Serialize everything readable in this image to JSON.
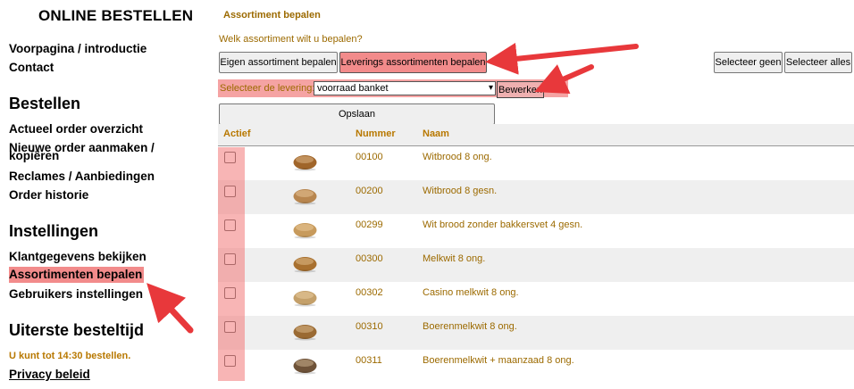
{
  "sidebar": {
    "title": "ONLINE BESTELLEN",
    "links_top": [
      "Voorpagina / introductie",
      "Contact"
    ],
    "bestellen": {
      "heading": "Bestellen",
      "items": [
        "Actueel order overzicht",
        "Nieuwe order aanmaken /",
        "kopiëren",
        "Reclames / Aanbiedingen",
        "Order historie"
      ]
    },
    "instellingen": {
      "heading": "Instellingen",
      "items": [
        "Klantgegevens bekijken",
        "Assortimenten bepalen",
        "Gebruikers instellingen"
      ]
    },
    "besteltijd": {
      "heading": "Uiterste besteltijd",
      "note": "U kunt tot 14:30 bestellen."
    },
    "privacy": "Privacy beleid"
  },
  "main": {
    "title": "Assortiment bepalen",
    "question": "Welk assortiment wilt u bepalen?",
    "buttons": {
      "eigen": "Eigen assortiment bepalen",
      "leverings": "Leverings assortimenten bepalen",
      "selecteer_geen": "Selecteer geen",
      "selecteer_alles": "Selecteer alles",
      "bewerken": "Bewerken",
      "opslaan": "Opslaan"
    },
    "levering": {
      "label": "Selecteer de levering:",
      "value": "voorraad banket"
    },
    "table": {
      "headers": [
        "Actief",
        "Nummer",
        "Naam"
      ],
      "rows": [
        {
          "nummer": "00100",
          "naam": "Witbrood 8 ong."
        },
        {
          "nummer": "00200",
          "naam": "Witbrood 8 gesn."
        },
        {
          "nummer": "00299",
          "naam": "Wit brood zonder bakkersvet 4 gesn."
        },
        {
          "nummer": "00300",
          "naam": "Melkwit 8 ong."
        },
        {
          "nummer": "00302",
          "naam": "Casino melkwit 8 ong."
        },
        {
          "nummer": "00310",
          "naam": "Boerenmelkwit 8 ong."
        },
        {
          "nummer": "00311",
          "naam": "Boerenmelkwit + maanzaad 8 ong."
        }
      ]
    }
  },
  "colors": {
    "accent_text": "#9c6a00",
    "highlight": "#f28b8b",
    "arrow": "#e8383b"
  },
  "icons": [
    "bread-icon",
    "chevron-down-icon",
    "arrow-annotation"
  ]
}
